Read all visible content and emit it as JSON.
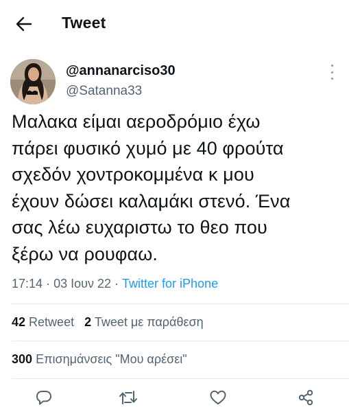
{
  "header": {
    "title": "Tweet",
    "back_icon": "arrow-left-icon"
  },
  "author": {
    "display_name": "@annanarciso30",
    "handle": "@Satanna33",
    "avatar": "avatar-photo"
  },
  "tweet": {
    "text": "Μαλακα είμαι αεροδρόμιο έχω\nπάρει φυσικό χυμό με 40 φρούτα\nσχεδόν χοντροκομμένα κ μου\nέχουν δώσει καλαμάκι στενό. Ένα\nσας λέω ευχαριστω το θεο που\nξέρω να ρουφαω.",
    "time": "17:14",
    "separator": "·",
    "date": "03 Ιουν 22",
    "source": "Twitter for iPhone"
  },
  "stats": {
    "retweets_count": "42",
    "retweets_label": "Retweet",
    "quotes_count": "2",
    "quotes_label": "Tweet με παράθεση",
    "likes_count": "300",
    "likes_label": "Επισημάνσεις \"Μου αρέσει\""
  },
  "actions": {
    "reply": "reply-icon",
    "retweet": "retweet-icon",
    "like": "heart-icon",
    "share": "share-icon"
  },
  "colors": {
    "text": "#0f1419",
    "secondary": "#536471",
    "link": "#1d9bf0",
    "divider": "#e6ecf0"
  }
}
